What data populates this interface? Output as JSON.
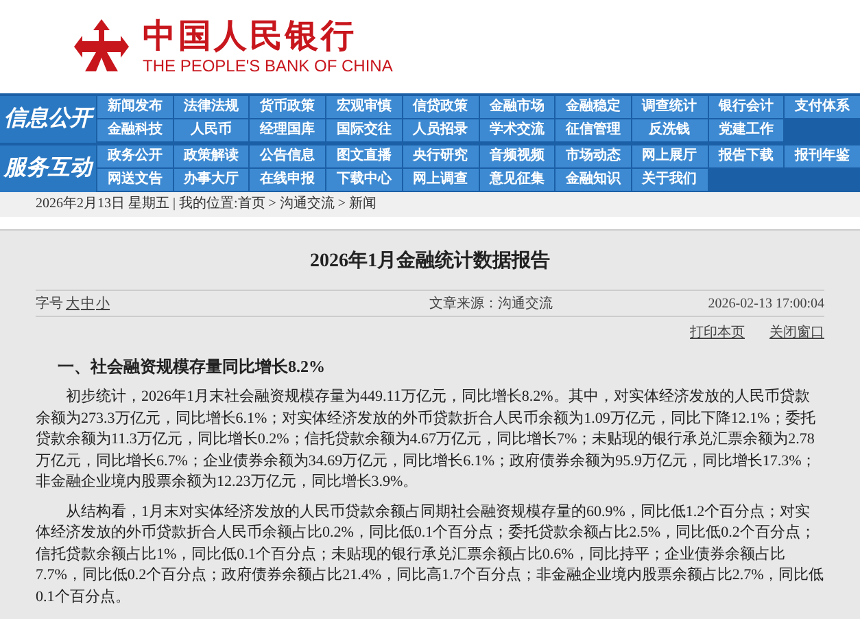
{
  "header": {
    "logo_cn": "中国人民银行",
    "logo_en": "THE PEOPLE'S BANK OF CHINA"
  },
  "nav": [
    {
      "label": "信息公开",
      "rows": [
        [
          "新闻发布",
          "法律法规",
          "货币政策",
          "宏观审慎",
          "信贷政策",
          "金融市场",
          "金融稳定",
          "调查统计",
          "银行会计",
          "支付体系"
        ],
        [
          "金融科技",
          "人民币",
          "经理国库",
          "国际交往",
          "人员招录",
          "学术交流",
          "征信管理",
          "反洗钱",
          "党建工作"
        ]
      ]
    },
    {
      "label": "服务互动",
      "rows": [
        [
          "政务公开",
          "政策解读",
          "公告信息",
          "图文直播",
          "央行研究",
          "音频视频",
          "市场动态",
          "网上展厅",
          "报告下载",
          "报刊年鉴"
        ],
        [
          "网送文告",
          "办事大厅",
          "在线申报",
          "下载中心",
          "网上调查",
          "意见征集",
          "金融知识",
          "关于我们"
        ]
      ]
    }
  ],
  "breadcrumb": "2026年2月13日 星期五 | 我的位置:首页 > 沟通交流 > 新闻",
  "article": {
    "title": "2026年1月金融统计数据报告",
    "font_size_label": "字号",
    "font_sizes": [
      "大",
      "中",
      "小"
    ],
    "source": "文章来源：沟通交流",
    "datetime": "2026-02-13 17:00:04",
    "actions": [
      "打印本页",
      "关闭窗口"
    ],
    "heading": "一、社会融资规模存量同比增长8.2%",
    "paragraphs": [
      "初步统计，2026年1月末社会融资规模存量为449.11万亿元，同比增长8.2%。其中，对实体经济发放的人民币贷款余额为273.3万亿元，同比增长6.1%；对实体经济发放的外币贷款折合人民币余额为1.09万亿元，同比下降12.1%；委托贷款余额为11.3万亿元，同比增长0.2%；信托贷款余额为4.67万亿元，同比增长7%；未贴现的银行承兑汇票余额为2.78万亿元，同比增长6.7%；企业债券余额为34.69万亿元，同比增长6.1%；政府债券余额为95.9万亿元，同比增长17.3%；非金融企业境内股票余额为12.23万亿元，同比增长3.9%。",
      "从结构看，1月末对实体经济发放的人民币贷款余额占同期社会融资规模存量的60.9%，同比低1.2个百分点；对实体经济发放的外币贷款折合人民币余额占比0.2%，同比低0.1个百分点；委托贷款余额占比2.5%，同比低0.2个百分点；信托贷款余额占比1%，同比低0.1个百分点；未贴现的银行承兑汇票余额占比0.6%，同比持平；企业债券余额占比7.7%，同比低0.2个百分点；政府债券余额占比21.4%，同比高1.7个百分点；非金融企业境内股票余额占比2.7%，同比低0.1个百分点。"
    ]
  }
}
